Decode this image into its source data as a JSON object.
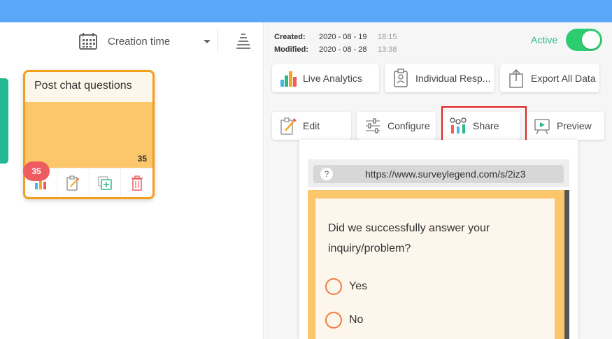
{
  "sort": {
    "label": "Creation time"
  },
  "card": {
    "title": "Post chat questions",
    "count": "35",
    "badge": "35"
  },
  "meta": {
    "created_label": "Created:",
    "created_date": "2020 - 08 - 19",
    "created_time": "18:15",
    "modified_label": "Modified:",
    "modified_date": "2020 - 08 - 28",
    "modified_time": "13:38"
  },
  "status": {
    "label": "Active",
    "on": true
  },
  "actions_row1": [
    {
      "label": "Live Analytics",
      "icon": "bar-chart-icon"
    },
    {
      "label": "Individual Resp...",
      "icon": "clipboard-person-icon"
    },
    {
      "label": "Export All Data",
      "icon": "export-icon"
    }
  ],
  "actions_row2": [
    {
      "label": "Edit",
      "icon": "edit-icon"
    },
    {
      "label": "Configure",
      "icon": "sliders-icon"
    },
    {
      "label": "Share",
      "icon": "share-icon"
    },
    {
      "label": "Preview",
      "icon": "preview-screen-icon"
    }
  ],
  "preview": {
    "help": "?",
    "url": "https://www.surveylegend.com/s/2iz3",
    "question": "Did we successfully answer your inquiry/problem?",
    "options": [
      "Yes",
      "No"
    ]
  },
  "colors": {
    "topbar": "#5aa6f8",
    "accent": "#f59d1c",
    "active": "#2ecc71",
    "highlight": "#e02020"
  }
}
